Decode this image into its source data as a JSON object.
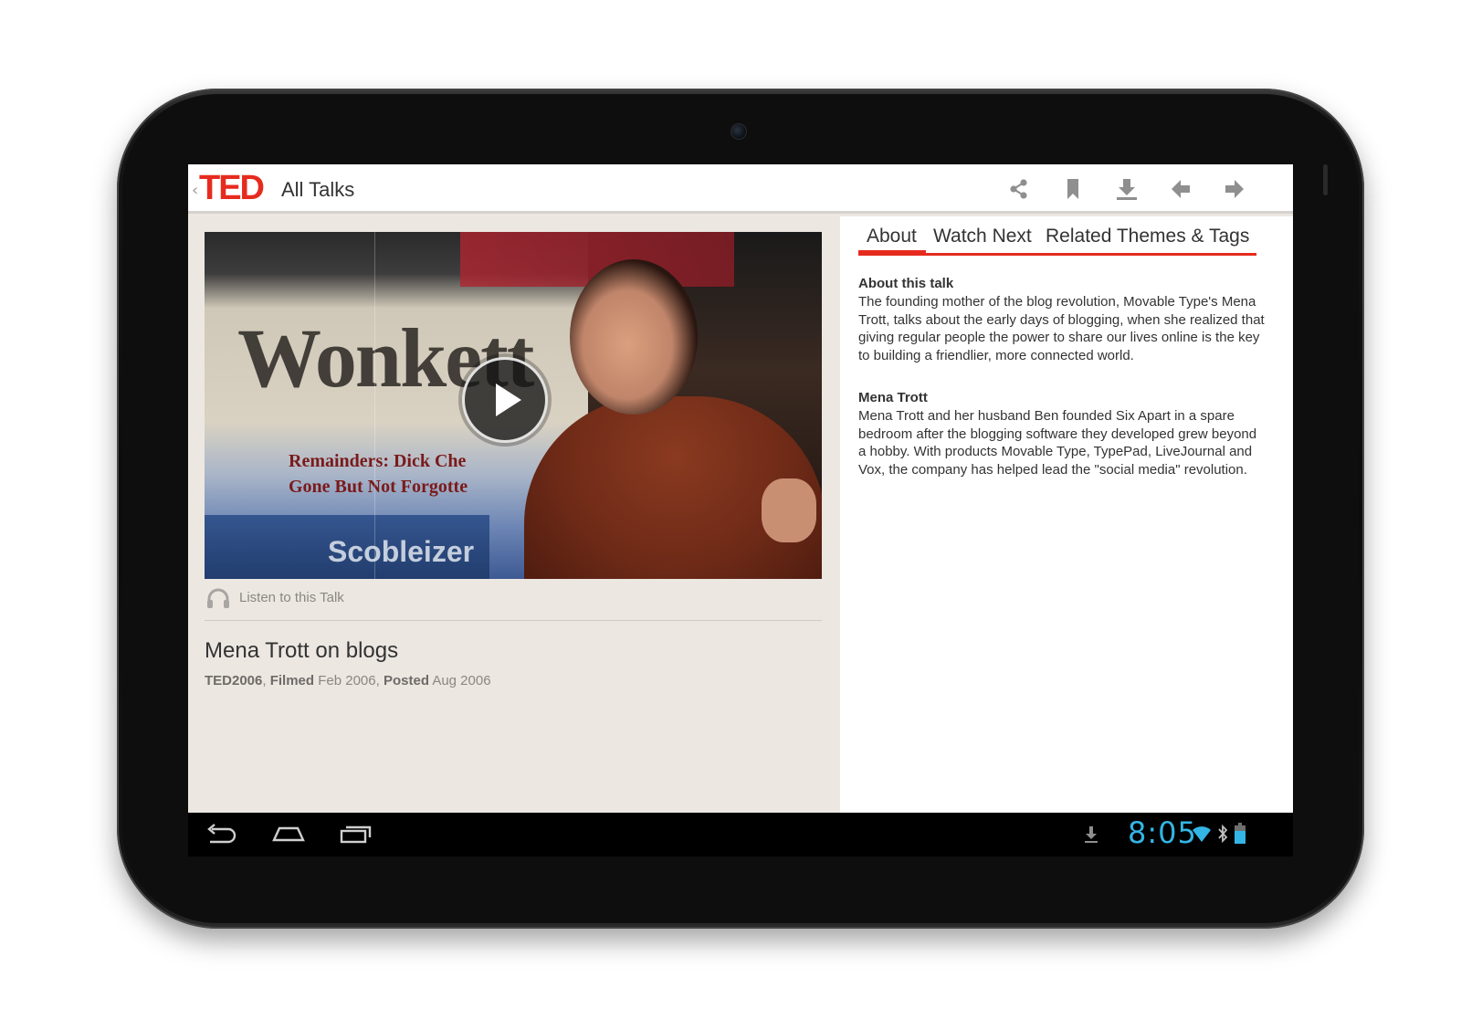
{
  "app": {
    "logo": "TED",
    "title": "All Talks"
  },
  "action_bar": {
    "icons": [
      "share-icon",
      "bookmark-icon",
      "download-icon",
      "previous-icon",
      "next-icon"
    ]
  },
  "talk": {
    "listen_label": "Listen to this Talk",
    "title": "Mena Trott on blogs",
    "event": "TED2006",
    "filmed_label": "Filmed",
    "filmed_date": "Feb 2006",
    "posted_label": "Posted",
    "posted_date": "Aug 2006"
  },
  "video": {
    "scene_text": {
      "masthead": "Wonkett",
      "headline_1": "Remainders: Dick Che",
      "headline_2": "Gone But Not Forgotte",
      "site": "Scobleizer"
    }
  },
  "tabs": [
    {
      "label": "About",
      "active": true
    },
    {
      "label": "Watch Next",
      "active": false
    },
    {
      "label": "Related Themes & Tags",
      "active": false
    }
  ],
  "about": {
    "heading": "About this talk",
    "body": "The founding mother of the blog revolution, Movable Type's Mena Trott, talks about the early days of blogging, when she realized that giving regular people the power to share our lives online is the key to building a friendlier, more connected world."
  },
  "speaker": {
    "heading": "Mena Trott",
    "body": "Mena Trott and her husband Ben founded Six Apart in a spare bedroom after the blogging software they developed grew beyond a hobby. With products Movable Type, TypePad, LiveJournal and Vox, the company has helped lead the \"social media\" revolution."
  },
  "system_bar": {
    "time": "8:05",
    "nav": [
      "back-icon",
      "home-icon",
      "recents-icon"
    ],
    "status_icons": [
      "download-notification-icon",
      "wifi-icon",
      "bluetooth-icon",
      "battery-icon"
    ]
  },
  "colors": {
    "accent": "#e62b1e",
    "clock": "#33b5e5",
    "left_pane_bg": "#ece7e1"
  }
}
